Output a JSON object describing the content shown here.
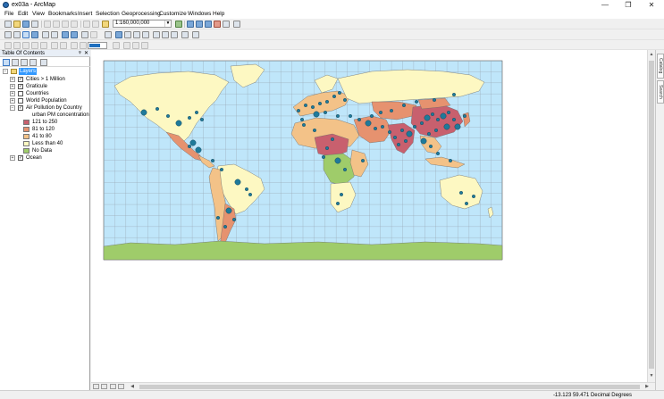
{
  "window": {
    "title": "ex03a - ArcMap",
    "minimize": "—",
    "maximize": "❐",
    "close": "✕"
  },
  "menu": [
    "File",
    "Edit",
    "View",
    "Bookmarks",
    "Insert",
    "Selection",
    "Geoprocessing",
    "Customize",
    "Windows",
    "Help"
  ],
  "toolbar": {
    "scale_value": "1:160,000,000"
  },
  "toc": {
    "title": "Table Of Contents",
    "pin": "ᵠ",
    "close": "✕",
    "root": "Layers",
    "layers": [
      {
        "name": "Cities > 1 Million",
        "checked": true
      },
      {
        "name": "Graticule",
        "checked": true
      },
      {
        "name": "Countries",
        "checked": false
      },
      {
        "name": "World Population",
        "checked": false
      },
      {
        "name": "Air Pollution by Country",
        "checked": true
      }
    ],
    "legend_heading": "urban PM concentration",
    "legend": [
      {
        "label": "121 to 250",
        "color": "#c8606e"
      },
      {
        "label": "81 to 120",
        "color": "#e6926f"
      },
      {
        "label": "41 to 80",
        "color": "#f3c288"
      },
      {
        "label": "Less than 40",
        "color": "#fdf8c2"
      },
      {
        "label": "No Data",
        "color": "#9fcc6a"
      }
    ],
    "ocean_layer": {
      "name": "Ocean",
      "checked": true
    }
  },
  "dock": {
    "catalog": "Catalog",
    "search": "Search"
  },
  "status": {
    "coords": "-13.123  59.471 Decimal Degrees"
  },
  "map_colors": {
    "ocean": "#bfe6fa",
    "graticule": "#9aa8b4",
    "city": "#1f7a9a"
  }
}
